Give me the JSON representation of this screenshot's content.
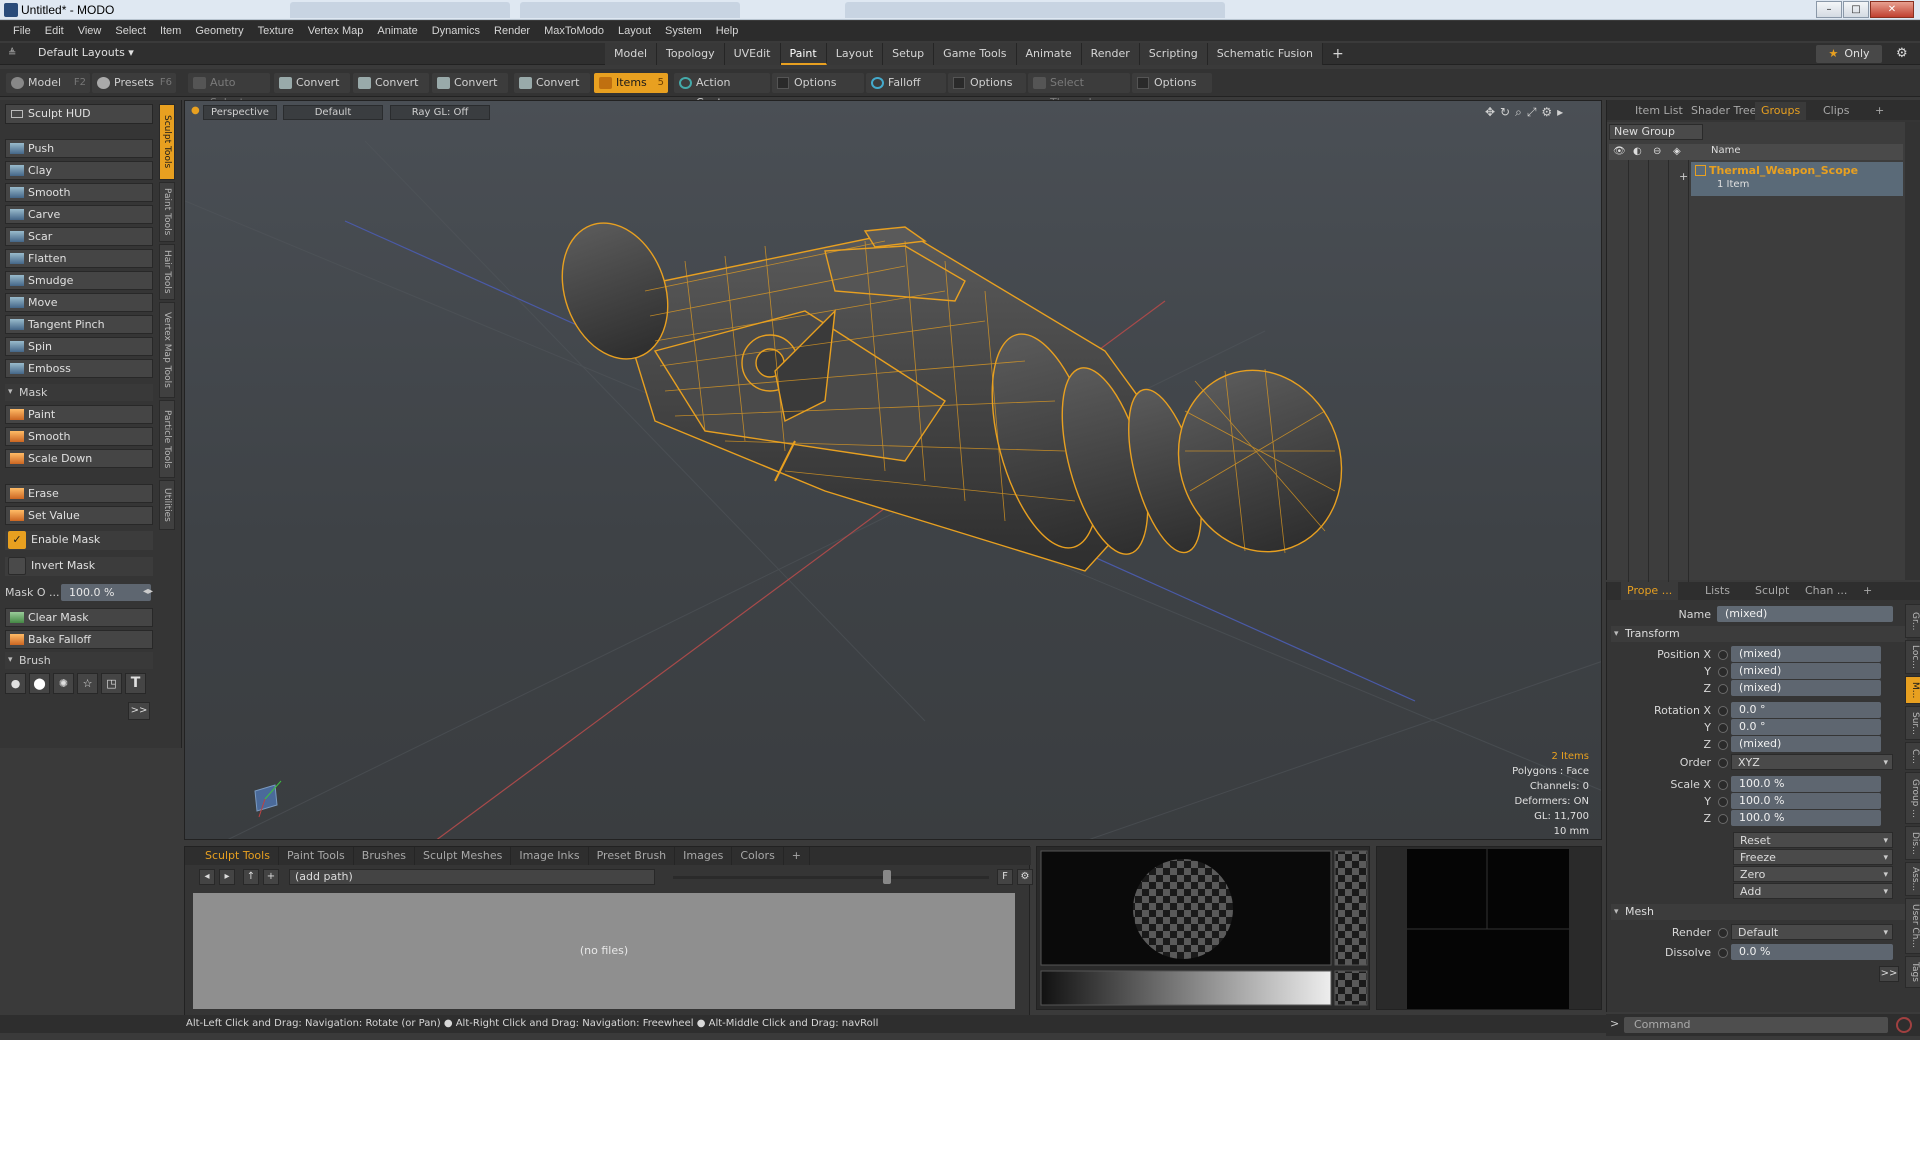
{
  "window": {
    "title": "Untitled* - MODO",
    "controls": [
      "–",
      "□",
      "✕"
    ]
  },
  "menu": [
    "File",
    "Edit",
    "View",
    "Select",
    "Item",
    "Geometry",
    "Texture",
    "Vertex Map",
    "Animate",
    "Dynamics",
    "Render",
    "MaxToModo",
    "Layout",
    "System",
    "Help"
  ],
  "layout_bar": {
    "default_layouts": "Default Layouts ▾",
    "tabs": [
      "Model",
      "Topology",
      "UVEdit",
      "Paint",
      "Layout",
      "Setup",
      "Game Tools",
      "Animate",
      "Render",
      "Scripting",
      "Schematic Fusion",
      "+"
    ],
    "active_tab": "Paint",
    "only": "Only"
  },
  "toolbar": {
    "model": "Model",
    "model_key": "F2",
    "presets": "Presets",
    "presets_key": "F6",
    "auto_select": "Auto Select",
    "convert1": "Convert",
    "convert2": "Convert",
    "convert3": "Convert",
    "convert4": "Convert",
    "items": "Items",
    "items_key": "5",
    "action_center": "Action Center",
    "options1": "Options",
    "falloff": "Falloff",
    "options2": "Options",
    "select_through": "Select Through",
    "options3": "Options"
  },
  "left_panel": {
    "sculpt_hud": "Sculpt HUD",
    "sculpt_tools": [
      "Push",
      "Clay",
      "Smooth",
      "Carve",
      "Scar",
      "Flatten",
      "Smudge",
      "Move",
      "Tangent Pinch",
      "Spin",
      "Emboss"
    ],
    "mask_section": "Mask",
    "mask_tools": [
      "Paint",
      "Smooth",
      "Scale Down"
    ],
    "erase": "Erase",
    "set_value": "Set Value",
    "enable_mask": "Enable Mask",
    "invert_mask": "Invert Mask",
    "mask_opacity_label": "Mask O ...",
    "mask_opacity_value": "100.0 %",
    "clear_mask": "Clear Mask",
    "bake_falloff": "Bake Falloff",
    "brush_section": "Brush",
    "brush_text_icon": "T",
    "more": ">>",
    "vertical_tabs": [
      "Sculpt Tools",
      "Paint Tools",
      "Hair Tools",
      "Vertex Map Tools",
      "Particle Tools",
      "Utilities"
    ]
  },
  "viewport": {
    "view": "Perspective",
    "shading": "Default",
    "raygl": "Ray GL: Off",
    "info": {
      "items": "2 Items",
      "polygons": "Polygons : Face",
      "channels": "Channels: 0",
      "deformers": "Deformers: ON",
      "gl": "GL: 11,700",
      "scale": "10 mm"
    },
    "wire_color": "#e8a020"
  },
  "bottom_panel": {
    "tabs": [
      "Sculpt Tools",
      "Paint Tools",
      "Brushes",
      "Sculpt Meshes",
      "Image Inks",
      "Preset Brush",
      "Images",
      "Colors",
      "+"
    ],
    "active_tab": "Sculpt Tools",
    "path": "(add path)",
    "empty": "(no files)"
  },
  "status": "Alt-Left Click and Drag: Navigation: Rotate (or Pan) ● Alt-Right Click and Drag: Navigation: Freewheel ● Alt-Middle Click and Drag: navRoll",
  "right_panel": {
    "tabs": [
      "Item List",
      "Shader Tree",
      "Groups",
      "Clips",
      "+"
    ],
    "active_tab": "Groups",
    "new_group": "New Group",
    "name_col": "Name",
    "group_name": "Thermal_Weapon_Scope",
    "group_count": "1 Item"
  },
  "properties": {
    "tabs": [
      "Prope ...",
      "Lists",
      "Sculpt",
      "Chan ...",
      "+"
    ],
    "name_label": "Name",
    "name_value": "(mixed)",
    "transform": "Transform",
    "rows": [
      {
        "label": "Position X",
        "value": "(mixed)"
      },
      {
        "label": "Y",
        "value": "(mixed)"
      },
      {
        "label": "Z",
        "value": "(mixed)"
      },
      {
        "label": "Rotation X",
        "value": "0.0 °"
      },
      {
        "label": "Y",
        "value": "0.0 °"
      },
      {
        "label": "Z",
        "value": "(mixed)"
      }
    ],
    "order_label": "Order",
    "order_value": "XYZ",
    "scale_rows": [
      {
        "label": "Scale X",
        "value": "100.0 %"
      },
      {
        "label": "Y",
        "value": "100.0 %"
      },
      {
        "label": "Z",
        "value": "100.0 %"
      }
    ],
    "actions": [
      "Reset",
      "Freeze",
      "Zero",
      "Add"
    ],
    "mesh": "Mesh",
    "render_label": "Render",
    "render_value": "Default",
    "dissolve_label": "Dissolve",
    "dissolve_value": "0.0 %",
    "more": ">>",
    "side_tabs": [
      "Gr...",
      "Loc...",
      "M...",
      "Sur...",
      "C...",
      "Group ...",
      "Dis...",
      "Ass...",
      "User Ch...",
      "Tags"
    ],
    "command_placeholder": "Command"
  }
}
